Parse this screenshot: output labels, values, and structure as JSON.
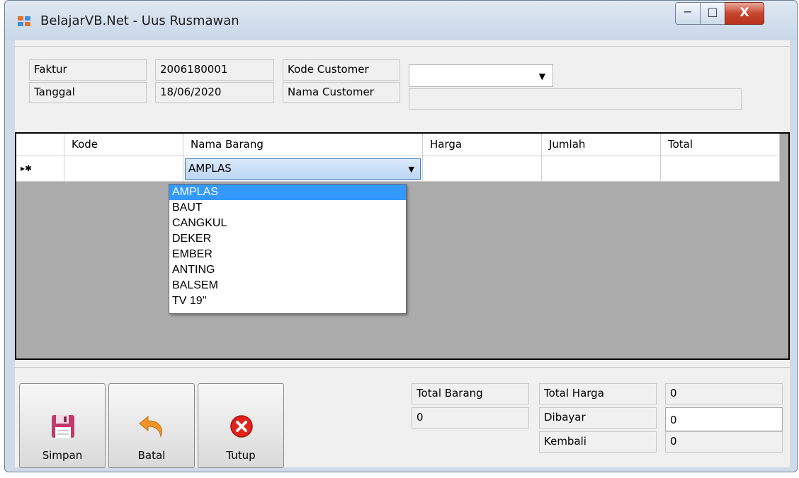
{
  "window": {
    "title": "BelajarVB.Net - Uus Rusmawan"
  },
  "controls": {
    "minimize": "−",
    "maximize": "□",
    "close": "X"
  },
  "header": {
    "faktur_label": "Faktur",
    "faktur_value": "2006180001",
    "tanggal_label": "Tanggal",
    "tanggal_value": "18/06/2020",
    "kode_customer_label": "Kode Customer",
    "kode_customer_value": "",
    "nama_customer_label": "Nama Customer",
    "nama_customer_value": ""
  },
  "grid": {
    "columns": [
      "Kode",
      "Nama Barang",
      "Harga",
      "Jumlah",
      "Total"
    ],
    "new_row_marker": "▸✱",
    "row": {
      "kode": "",
      "nama_barang": "AMPLAS",
      "harga": "",
      "jumlah": "",
      "total": ""
    }
  },
  "dropdown": {
    "items": [
      "AMPLAS",
      "BAUT",
      "CANGKUL",
      "DEKER",
      "EMBER",
      "ANTING",
      "BALSEM",
      "TV 19''"
    ],
    "selected": "AMPLAS"
  },
  "buttons": {
    "simpan": "Simpan",
    "batal": "Batal",
    "tutup": "Tutup"
  },
  "summary": {
    "total_barang_label": "Total Barang",
    "total_barang_value": "0",
    "total_harga_label": "Total Harga",
    "total_harga_value": "0",
    "dibayar_label": "Dibayar",
    "dibayar_value": "0",
    "kembali_label": "Kembali",
    "kembali_value": "0"
  },
  "icons": {
    "app": "app-form-icon",
    "save": "floppy-disk-icon",
    "cancel": "undo-arrow-icon",
    "close": "red-x-circle-icon"
  },
  "colors": {
    "selection": "#3399ff",
    "grid_background": "#ababab",
    "close_button": "#c7462f"
  }
}
